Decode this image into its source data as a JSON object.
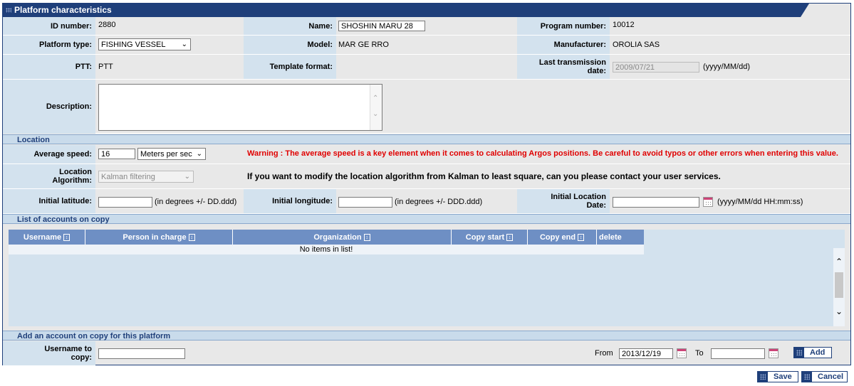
{
  "title": "Platform characteristics",
  "fields": {
    "id_number": {
      "label": "ID number:",
      "value": "2880"
    },
    "name": {
      "label": "Name:",
      "value": "SHOSHIN MARU 28"
    },
    "program_number": {
      "label": "Program number:",
      "value": "10012"
    },
    "platform_type": {
      "label": "Platform type:",
      "value": "FISHING VESSEL"
    },
    "model": {
      "label": "Model:",
      "value": "MAR GE RRO"
    },
    "manufacturer": {
      "label": "Manufacturer:",
      "value": "OROLIA SAS"
    },
    "ptt": {
      "label": "PTT:",
      "value": "PTT"
    },
    "template_format": {
      "label": "Template format:",
      "value": ""
    },
    "last_transmission": {
      "label_l1": "Last transmission",
      "label_l2": "date:",
      "value": "2009/07/21",
      "hint": "(yyyy/MM/dd)"
    },
    "description": {
      "label": "Description:",
      "value": ""
    }
  },
  "location": {
    "section": "Location",
    "avg_speed_label": "Average speed:",
    "avg_speed_value": "16",
    "avg_speed_unit": "Meters per sec",
    "warning": "Warning : The average speed is a key element when it comes to calculating Argos positions. Be careful to avoid typos or other errors when entering this value.",
    "algo_label_l1": "Location",
    "algo_label_l2": "Algorithm:",
    "algo_value": "Kalman filtering",
    "algo_note": "If you want to modify the location algorithm from Kalman to least square, can you please contact your user services.",
    "lat_label": "Initial latitude:",
    "lat_hint": "(in degrees +/- DD.ddd)",
    "lon_label": "Initial longitude:",
    "lon_hint": "(in degrees +/- DDD.ddd)",
    "date_label_l1": "Initial Location",
    "date_label_l2": "Date:",
    "date_hint": "(yyyy/MM/dd HH:mm:ss)"
  },
  "accounts": {
    "section": "List of accounts on copy",
    "columns": [
      "Username",
      "Person in charge",
      "Organization",
      "Copy start",
      "Copy end",
      "delete"
    ],
    "empty": "No items in list!"
  },
  "add": {
    "section": "Add an account on copy for this platform",
    "user_label_l1": "Username to",
    "user_label_l2": "copy:",
    "from_label": "From",
    "from_value": "2013/12/19",
    "to_label": "To",
    "add_label": "Add"
  },
  "buttons": {
    "save": "Save",
    "cancel": "Cancel"
  }
}
